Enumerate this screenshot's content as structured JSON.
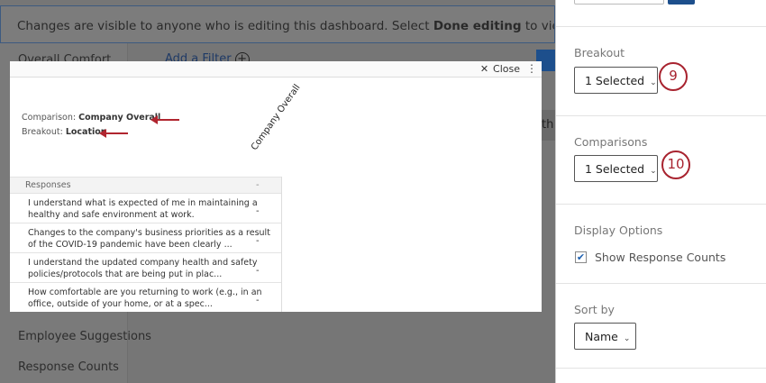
{
  "banner": {
    "text_before": "Changes are visible to anyone who is editing this dashboard. Select ",
    "bold": "Done editing",
    "text_after": " to view publishing options."
  },
  "sidebar": {
    "items": [
      "Overall Comfort",
      "Employee Suggestions",
      "Response Counts"
    ]
  },
  "toolbar": {
    "add_filter": "Add a Filter",
    "plus": "+"
  },
  "background_text": "th",
  "modal": {
    "close_label": "Close",
    "close_icon": "✕",
    "menu_icon": "⋮",
    "comparison_label": "Comparison:",
    "comparison_value": "Company Overall",
    "breakout_label": "Breakout:",
    "breakout_value": "Location",
    "column_header": "Company Overall",
    "table": {
      "header": "Responses",
      "header_value": "-",
      "rows": [
        {
          "text": "I understand what is expected of me in maintaining a healthy and safe environment at work.",
          "value": "-"
        },
        {
          "text": "Changes to the company's business priorities as a result of the COVID-19 pandemic have been clearly ...",
          "value": "-"
        },
        {
          "text": "I understand the updated company health and safety policies/protocols that are being put in plac...",
          "value": "-"
        },
        {
          "text": "How comfortable are you returning to work (e.g., in an office, outside of your home, or at a spec...",
          "value": "-"
        }
      ]
    }
  },
  "panel": {
    "breakout": {
      "label": "Breakout",
      "value": "1 Selected",
      "badge": "9"
    },
    "comparisons": {
      "label": "Comparisons",
      "value": "1 Selected",
      "badge": "10"
    },
    "display_options": {
      "label": "Display Options",
      "checkbox_label": "Show Response Counts",
      "checked": true
    },
    "sort_by": {
      "label": "Sort by",
      "value": "Name"
    },
    "chevron": "⌄"
  },
  "colors": {
    "accent": "#1d4f8c",
    "annotation": "#a8232f"
  }
}
